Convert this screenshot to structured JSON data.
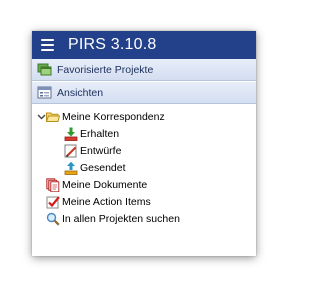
{
  "app": {
    "title": "PIRS 3.10.8"
  },
  "sections": {
    "favorites_label": "Favorisierte Projekte",
    "views_label": "Ansichten"
  },
  "tree": {
    "correspondence": {
      "label": "Meine Korrespondenz",
      "expanded": true,
      "children": {
        "received": "Erhalten",
        "drafts": "Entwürfe",
        "sent": "Gesendet"
      }
    },
    "documents": "Meine Dokumente",
    "action_items": "Meine Action Items",
    "search_all": "In allen Projekten suchen"
  },
  "colors": {
    "titlebar": "#23408a",
    "section_text": "#1c2f5c"
  }
}
